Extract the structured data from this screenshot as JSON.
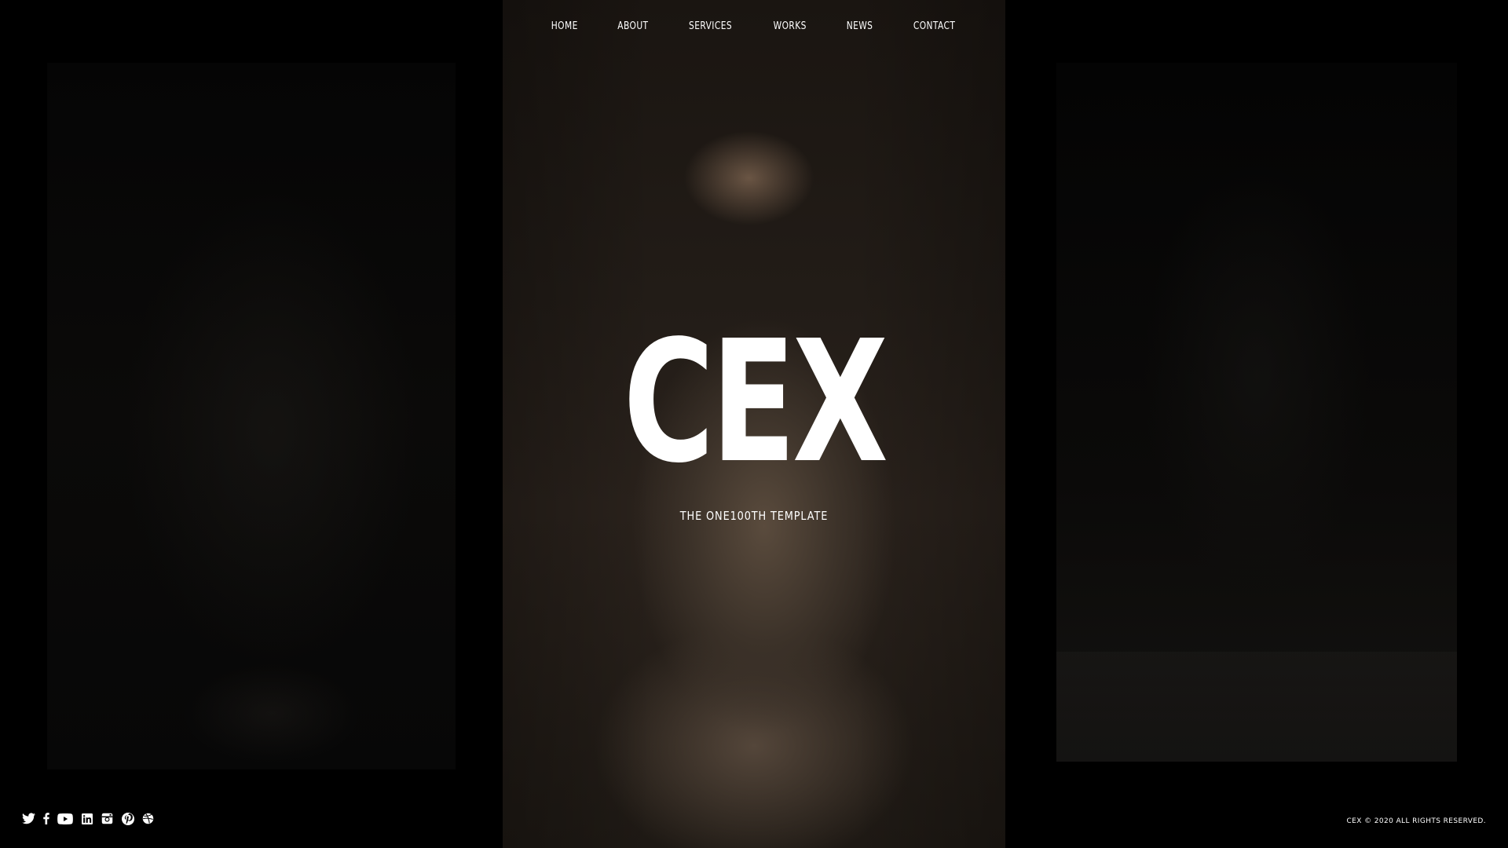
{
  "nav": {
    "items": [
      {
        "label": "HOME"
      },
      {
        "label": "ABOUT"
      },
      {
        "label": "SERVICES"
      },
      {
        "label": "WORKS"
      },
      {
        "label": "NEWS"
      },
      {
        "label": "CONTACT"
      }
    ]
  },
  "hero": {
    "title": "CEX",
    "subtitle": "THE ONE100TH TEMPLATE"
  },
  "social": {
    "icons": [
      "twitter-icon",
      "facebook-icon",
      "youtube-icon",
      "linkedin-icon",
      "instagram-icon",
      "pinterest-icon",
      "dribbble-icon"
    ]
  },
  "footer": {
    "copyright": "CEX © 2020 ALL RIGHTS RESERVED."
  },
  "colors": {
    "background": "#000000",
    "text": "#ffffff",
    "photo_tone": "#3c3229"
  }
}
